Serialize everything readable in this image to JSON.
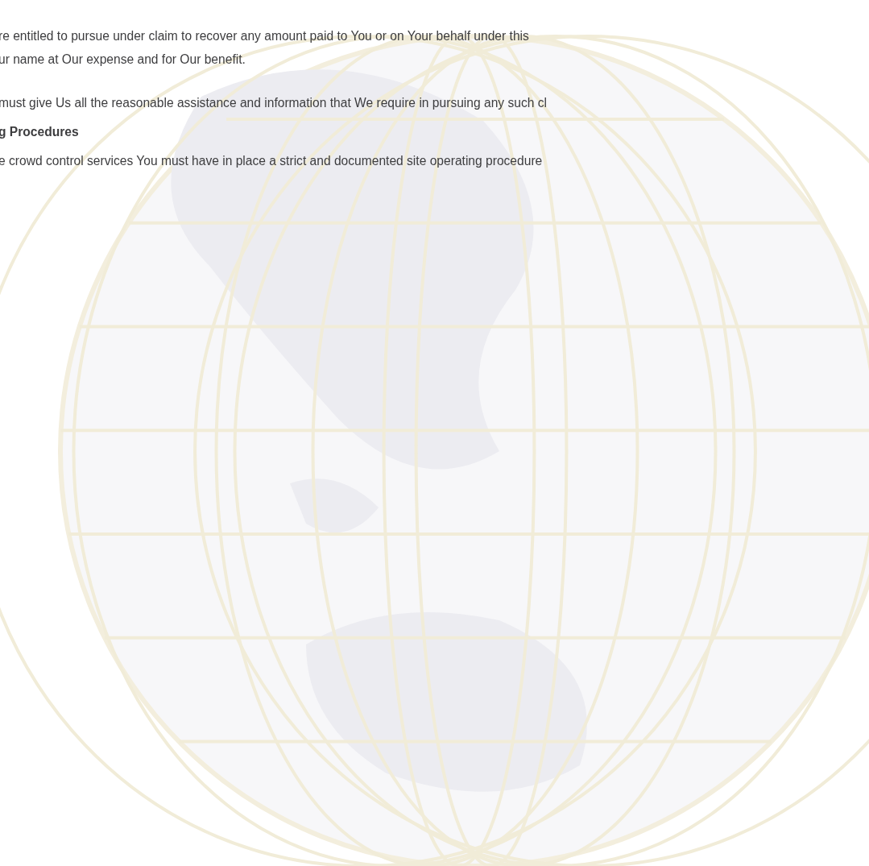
{
  "paragraphs": [
    {
      "kind": "text",
      "text": "re entitled to pursue under claim to recover any amount paid to You or on Your behalf under this"
    },
    {
      "kind": "text",
      "text": "ur name at Our expense and for Our benefit."
    },
    {
      "kind": "gap"
    },
    {
      "kind": "text",
      "text": "must give Us all the reasonable assistance and information that We require in pursuing any such cl"
    },
    {
      "kind": "heading",
      "text": "g Procedures"
    },
    {
      "kind": "text",
      "text": "e crowd control services You must have in place a strict and documented site operating procedure"
    }
  ]
}
